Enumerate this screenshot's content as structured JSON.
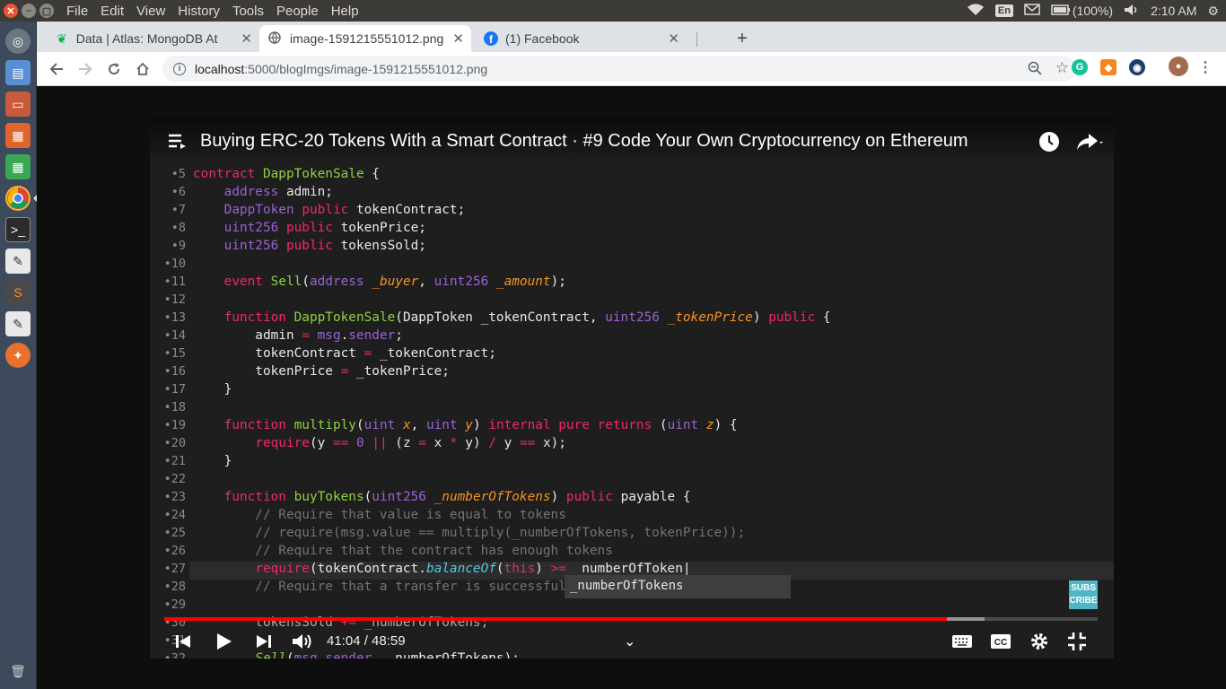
{
  "system": {
    "menu": [
      "File",
      "Edit",
      "View",
      "History",
      "Tools",
      "People",
      "Help"
    ],
    "keyboard_layout": "En",
    "battery": "(100%)",
    "clock": "2:10 AM"
  },
  "launcher": {
    "items": [
      "chromium-icon",
      "files-icon",
      "drive-icon",
      "document-icon",
      "spreadsheet-icon",
      "chrome-icon",
      "terminal-icon",
      "text-editor-icon",
      "sublime-icon",
      "notes-icon",
      "compass-icon",
      "trash-icon"
    ]
  },
  "tabs": [
    {
      "title": "Data | Atlas: MongoDB At",
      "icon": "mongodb-leaf-icon",
      "active": false
    },
    {
      "title": "image-1591215551012.png",
      "icon": "globe-icon",
      "active": true
    },
    {
      "title": "(1) Facebook",
      "icon": "facebook-icon",
      "active": false
    }
  ],
  "omnibox": {
    "host": "localhost",
    "path": ":5000/blogImgs/image-1591215551012.png"
  },
  "video": {
    "title": "Buying ERC-20 Tokens With a Smart Contract · #9 Code Your Own Cryptocurrency on Ethereum",
    "time_current": "41:04",
    "time_total": "48:59",
    "time_display": "41:04 / 48:59",
    "progress_fraction": 0.838,
    "subscribe_label": "SUBS\nCRIBE",
    "autocomplete": "_numberOfTokens"
  },
  "code": {
    "line_numbers": [
      "5",
      "6",
      "7",
      "8",
      "9",
      "10",
      "11",
      "12",
      "13",
      "14",
      "15",
      "16",
      "17",
      "18",
      "19",
      "20",
      "21",
      "22",
      "23",
      "24",
      "25",
      "26",
      "27",
      "28",
      "29",
      "30",
      "31",
      "32"
    ]
  },
  "colors": {
    "keyword": "#f0266f",
    "type": "#9a62d6",
    "function": "#8fd13d",
    "param": "#f7941d",
    "comment": "#737373",
    "progress": "#ff0000"
  }
}
